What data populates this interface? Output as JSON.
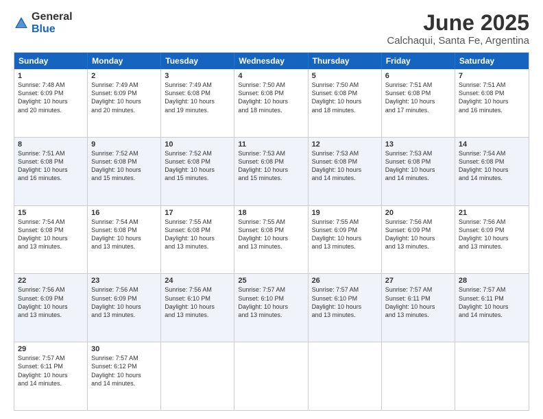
{
  "logo": {
    "general": "General",
    "blue": "Blue"
  },
  "title": "June 2025",
  "subtitle": "Calchaqui, Santa Fe, Argentina",
  "header_days": [
    "Sunday",
    "Monday",
    "Tuesday",
    "Wednesday",
    "Thursday",
    "Friday",
    "Saturday"
  ],
  "rows": [
    {
      "alt": false,
      "cells": [
        {
          "day": "1",
          "lines": [
            "Sunrise: 7:48 AM",
            "Sunset: 6:09 PM",
            "Daylight: 10 hours",
            "and 20 minutes."
          ]
        },
        {
          "day": "2",
          "lines": [
            "Sunrise: 7:49 AM",
            "Sunset: 6:09 PM",
            "Daylight: 10 hours",
            "and 20 minutes."
          ]
        },
        {
          "day": "3",
          "lines": [
            "Sunrise: 7:49 AM",
            "Sunset: 6:08 PM",
            "Daylight: 10 hours",
            "and 19 minutes."
          ]
        },
        {
          "day": "4",
          "lines": [
            "Sunrise: 7:50 AM",
            "Sunset: 6:08 PM",
            "Daylight: 10 hours",
            "and 18 minutes."
          ]
        },
        {
          "day": "5",
          "lines": [
            "Sunrise: 7:50 AM",
            "Sunset: 6:08 PM",
            "Daylight: 10 hours",
            "and 18 minutes."
          ]
        },
        {
          "day": "6",
          "lines": [
            "Sunrise: 7:51 AM",
            "Sunset: 6:08 PM",
            "Daylight: 10 hours",
            "and 17 minutes."
          ]
        },
        {
          "day": "7",
          "lines": [
            "Sunrise: 7:51 AM",
            "Sunset: 6:08 PM",
            "Daylight: 10 hours",
            "and 16 minutes."
          ]
        }
      ]
    },
    {
      "alt": true,
      "cells": [
        {
          "day": "8",
          "lines": [
            "Sunrise: 7:51 AM",
            "Sunset: 6:08 PM",
            "Daylight: 10 hours",
            "and 16 minutes."
          ]
        },
        {
          "day": "9",
          "lines": [
            "Sunrise: 7:52 AM",
            "Sunset: 6:08 PM",
            "Daylight: 10 hours",
            "and 15 minutes."
          ]
        },
        {
          "day": "10",
          "lines": [
            "Sunrise: 7:52 AM",
            "Sunset: 6:08 PM",
            "Daylight: 10 hours",
            "and 15 minutes."
          ]
        },
        {
          "day": "11",
          "lines": [
            "Sunrise: 7:53 AM",
            "Sunset: 6:08 PM",
            "Daylight: 10 hours",
            "and 15 minutes."
          ]
        },
        {
          "day": "12",
          "lines": [
            "Sunrise: 7:53 AM",
            "Sunset: 6:08 PM",
            "Daylight: 10 hours",
            "and 14 minutes."
          ]
        },
        {
          "day": "13",
          "lines": [
            "Sunrise: 7:53 AM",
            "Sunset: 6:08 PM",
            "Daylight: 10 hours",
            "and 14 minutes."
          ]
        },
        {
          "day": "14",
          "lines": [
            "Sunrise: 7:54 AM",
            "Sunset: 6:08 PM",
            "Daylight: 10 hours",
            "and 14 minutes."
          ]
        }
      ]
    },
    {
      "alt": false,
      "cells": [
        {
          "day": "15",
          "lines": [
            "Sunrise: 7:54 AM",
            "Sunset: 6:08 PM",
            "Daylight: 10 hours",
            "and 13 minutes."
          ]
        },
        {
          "day": "16",
          "lines": [
            "Sunrise: 7:54 AM",
            "Sunset: 6:08 PM",
            "Daylight: 10 hours",
            "and 13 minutes."
          ]
        },
        {
          "day": "17",
          "lines": [
            "Sunrise: 7:55 AM",
            "Sunset: 6:08 PM",
            "Daylight: 10 hours",
            "and 13 minutes."
          ]
        },
        {
          "day": "18",
          "lines": [
            "Sunrise: 7:55 AM",
            "Sunset: 6:08 PM",
            "Daylight: 10 hours",
            "and 13 minutes."
          ]
        },
        {
          "day": "19",
          "lines": [
            "Sunrise: 7:55 AM",
            "Sunset: 6:09 PM",
            "Daylight: 10 hours",
            "and 13 minutes."
          ]
        },
        {
          "day": "20",
          "lines": [
            "Sunrise: 7:56 AM",
            "Sunset: 6:09 PM",
            "Daylight: 10 hours",
            "and 13 minutes."
          ]
        },
        {
          "day": "21",
          "lines": [
            "Sunrise: 7:56 AM",
            "Sunset: 6:09 PM",
            "Daylight: 10 hours",
            "and 13 minutes."
          ]
        }
      ]
    },
    {
      "alt": true,
      "cells": [
        {
          "day": "22",
          "lines": [
            "Sunrise: 7:56 AM",
            "Sunset: 6:09 PM",
            "Daylight: 10 hours",
            "and 13 minutes."
          ]
        },
        {
          "day": "23",
          "lines": [
            "Sunrise: 7:56 AM",
            "Sunset: 6:09 PM",
            "Daylight: 10 hours",
            "and 13 minutes."
          ]
        },
        {
          "day": "24",
          "lines": [
            "Sunrise: 7:56 AM",
            "Sunset: 6:10 PM",
            "Daylight: 10 hours",
            "and 13 minutes."
          ]
        },
        {
          "day": "25",
          "lines": [
            "Sunrise: 7:57 AM",
            "Sunset: 6:10 PM",
            "Daylight: 10 hours",
            "and 13 minutes."
          ]
        },
        {
          "day": "26",
          "lines": [
            "Sunrise: 7:57 AM",
            "Sunset: 6:10 PM",
            "Daylight: 10 hours",
            "and 13 minutes."
          ]
        },
        {
          "day": "27",
          "lines": [
            "Sunrise: 7:57 AM",
            "Sunset: 6:11 PM",
            "Daylight: 10 hours",
            "and 13 minutes."
          ]
        },
        {
          "day": "28",
          "lines": [
            "Sunrise: 7:57 AM",
            "Sunset: 6:11 PM",
            "Daylight: 10 hours",
            "and 14 minutes."
          ]
        }
      ]
    },
    {
      "alt": false,
      "cells": [
        {
          "day": "29",
          "lines": [
            "Sunrise: 7:57 AM",
            "Sunset: 6:11 PM",
            "Daylight: 10 hours",
            "and 14 minutes."
          ]
        },
        {
          "day": "30",
          "lines": [
            "Sunrise: 7:57 AM",
            "Sunset: 6:12 PM",
            "Daylight: 10 hours",
            "and 14 minutes."
          ]
        },
        {
          "day": "",
          "lines": []
        },
        {
          "day": "",
          "lines": []
        },
        {
          "day": "",
          "lines": []
        },
        {
          "day": "",
          "lines": []
        },
        {
          "day": "",
          "lines": []
        }
      ]
    }
  ]
}
